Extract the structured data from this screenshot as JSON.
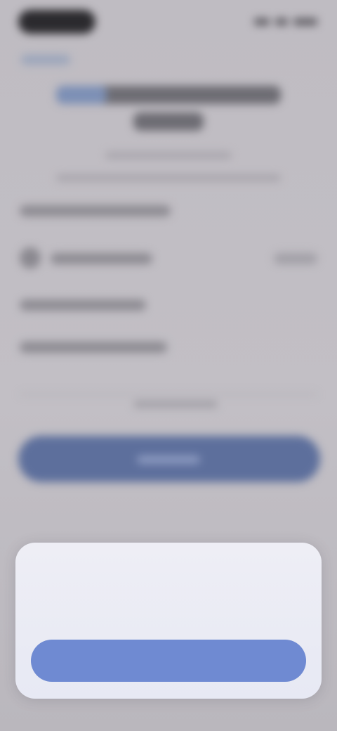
{
  "colors": {
    "background": "#bfbcc2",
    "primary_button": "#5d6f9c",
    "sheet_button": "#6f8ad2",
    "sheet_background": "#eeeef5"
  },
  "sheet": {
    "title": "",
    "message": "",
    "button_label": ""
  }
}
